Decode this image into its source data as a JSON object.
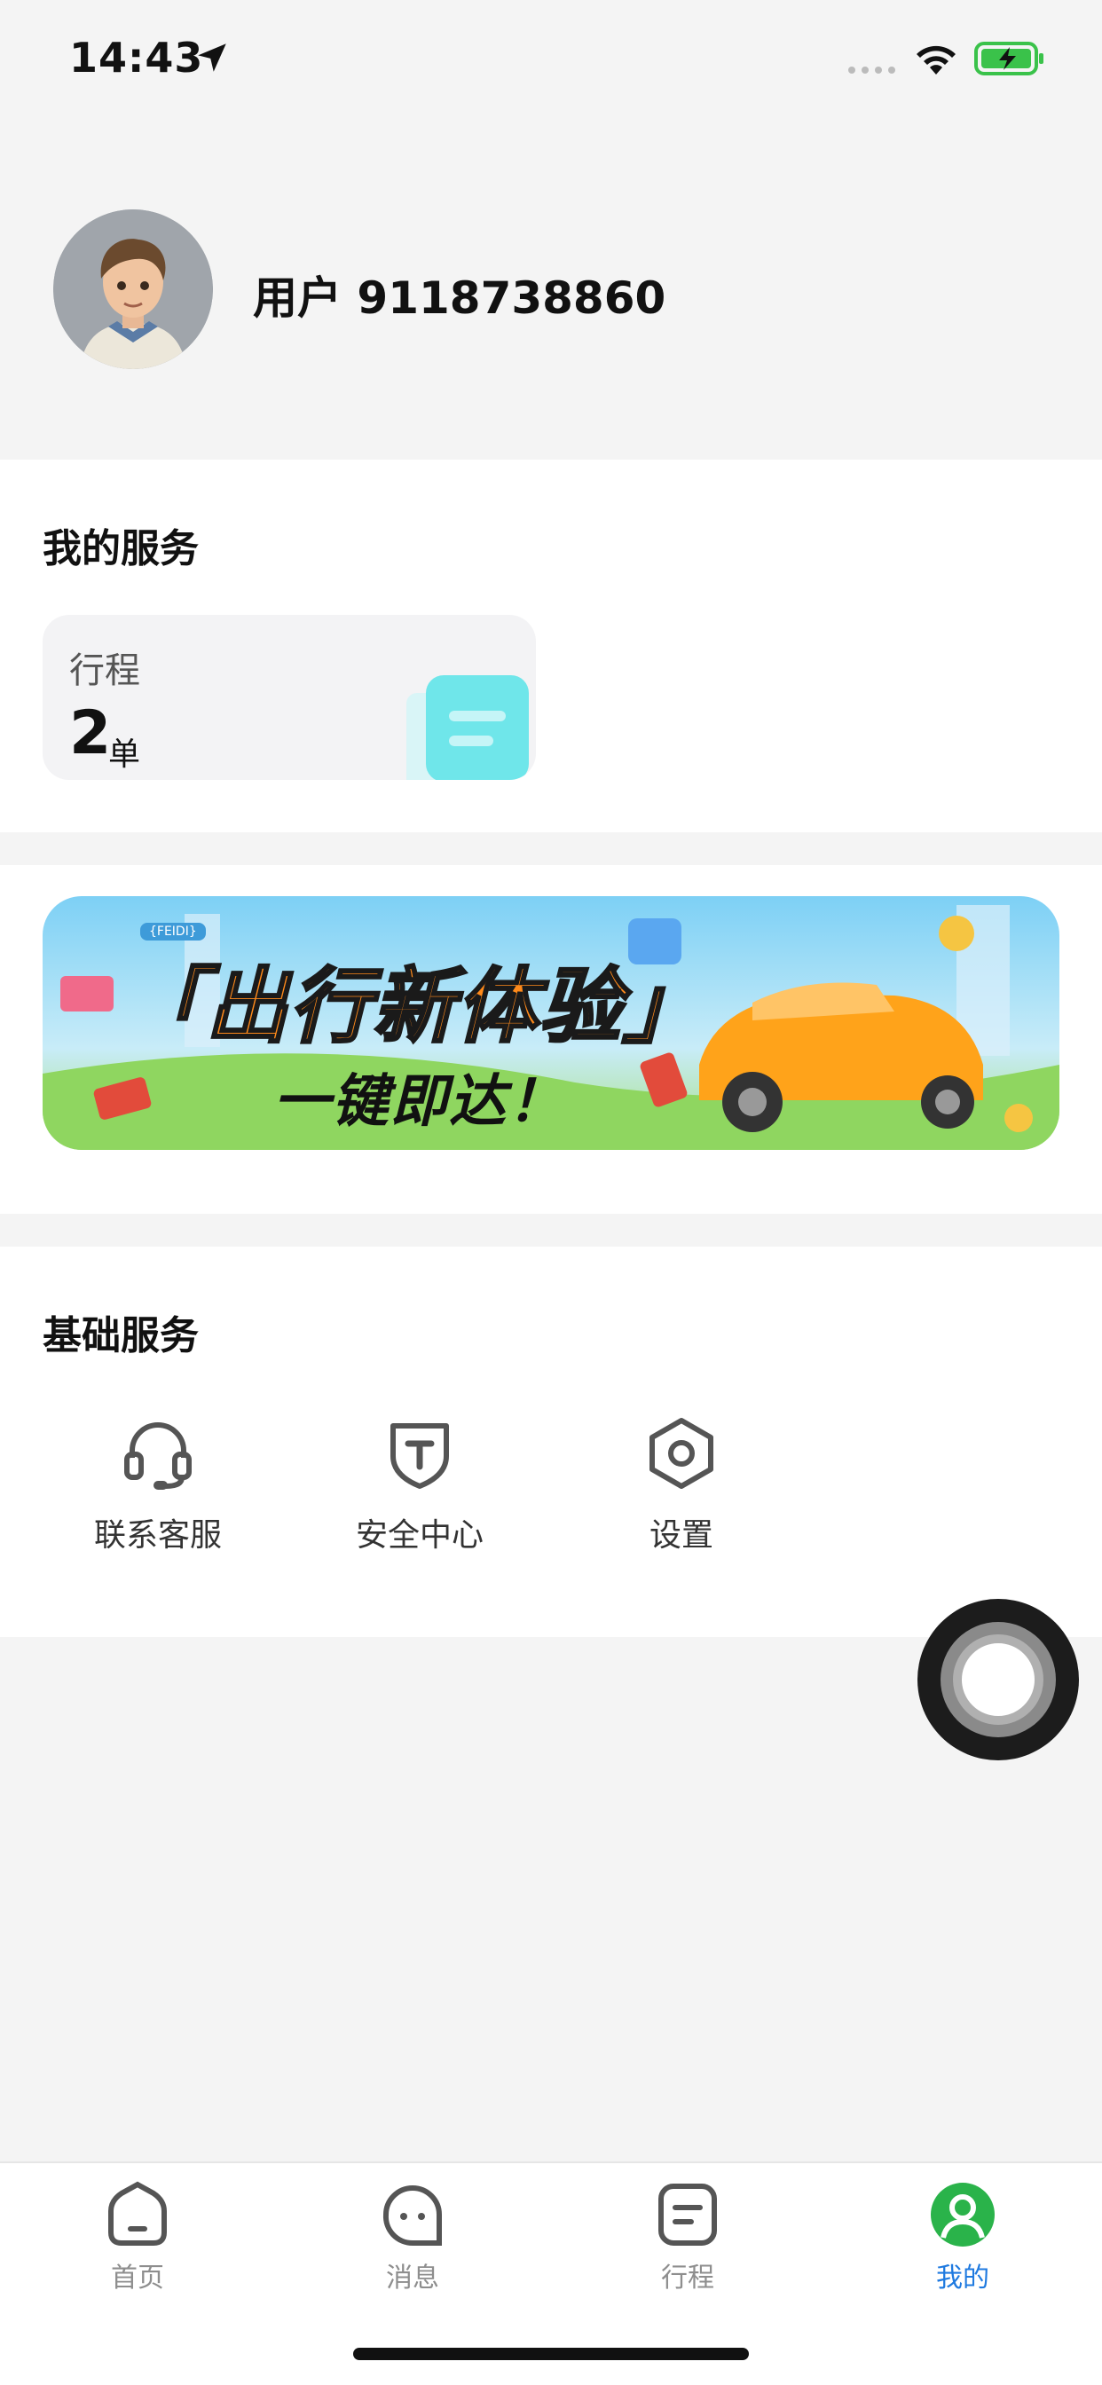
{
  "status_bar": {
    "time": "14:43"
  },
  "profile": {
    "username": "用户 9118738860"
  },
  "my_services": {
    "title": "我的服务",
    "trip": {
      "label": "行程",
      "count": "2",
      "unit": "单"
    }
  },
  "banner": {
    "title": "「出行新体验」",
    "subtitle": "一键即达！",
    "tag": "{FEIDI}"
  },
  "basic_services": {
    "title": "基础服务",
    "items": [
      {
        "label": "联系客服",
        "icon": "headset-icon"
      },
      {
        "label": "安全中心",
        "icon": "shield-icon"
      },
      {
        "label": "设置",
        "icon": "gear-icon"
      }
    ]
  },
  "tabbar": {
    "tabs": [
      {
        "label": "首页",
        "icon": "home-icon",
        "active": false
      },
      {
        "label": "消息",
        "icon": "message-icon",
        "active": false
      },
      {
        "label": "行程",
        "icon": "trip-icon",
        "active": false
      },
      {
        "label": "我的",
        "icon": "profile-icon",
        "active": true
      }
    ],
    "active_color": "#1f7ae0",
    "inactive_color": "#8e8e8e"
  },
  "colors": {
    "accent": "#1f7ae0",
    "trip_icon": "#5ee0e6",
    "banner_title": "#ff8a1a"
  }
}
